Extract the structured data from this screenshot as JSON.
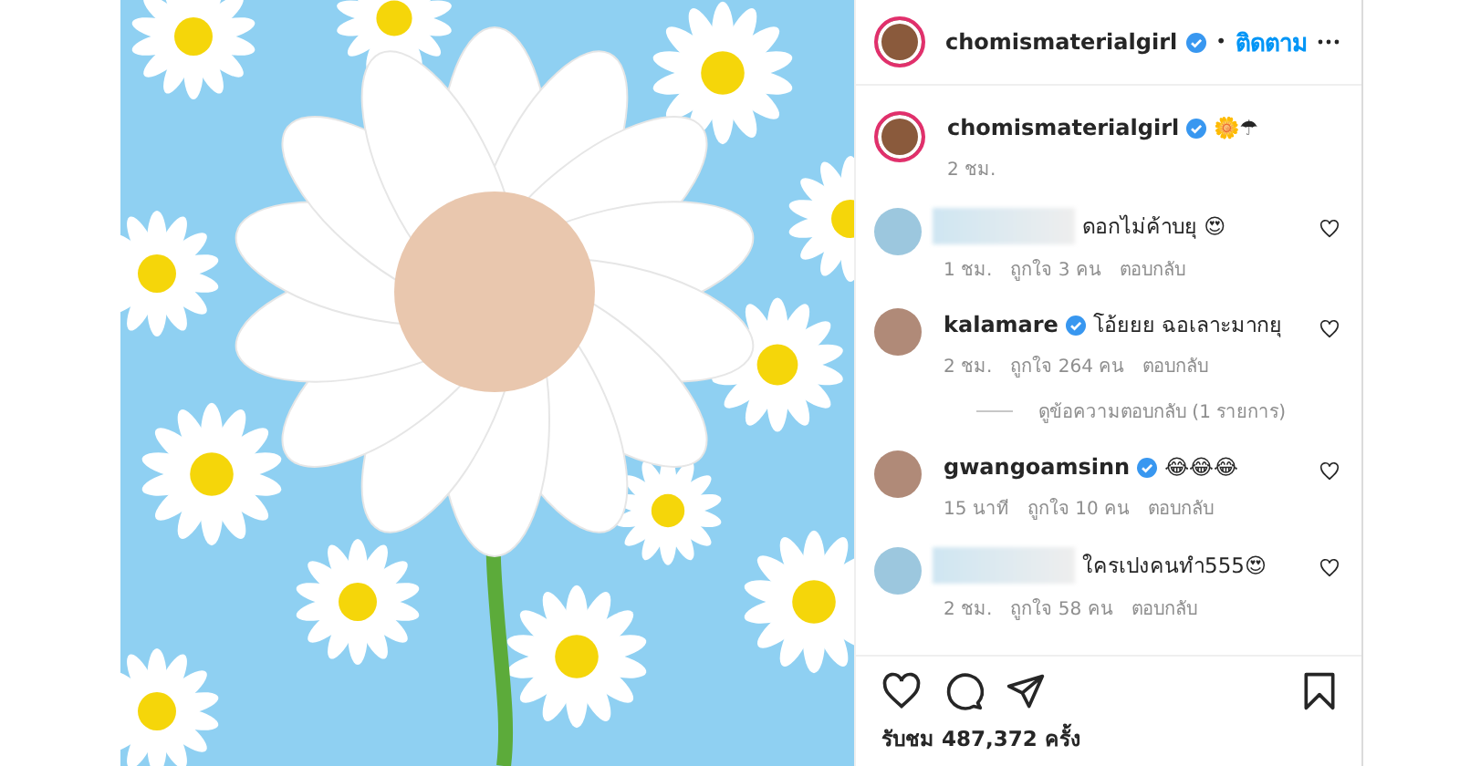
{
  "post": {
    "username": "chomismaterialgirl",
    "verified": true,
    "separator": "•",
    "follow": "ติดตาม"
  },
  "caption": {
    "username": "chomismaterialgirl",
    "verified": true,
    "text": "🌼☂",
    "time": "2 ชม."
  },
  "comments": [
    {
      "kind": "redacted",
      "text": "ดอกไม่ค้าบยุ 😍",
      "time": "1 ชม.",
      "likes": "ถูกใจ 3 คน",
      "reply": "ตอบกลับ",
      "liked": false
    },
    {
      "kind": "user",
      "username": "kalamare",
      "verified": true,
      "text": "โอ้ยยย ฉอเลาะมากยุ",
      "time": "2 ชม.",
      "likes": "ถูกใจ 264 คน",
      "reply": "ตอบกลับ",
      "liked": false,
      "replies_link": "ดูข้อความตอบกลับ (1 รายการ)"
    },
    {
      "kind": "user",
      "username": "gwangoamsinn",
      "verified": true,
      "text": "😂😂😂",
      "time": "15 นาที",
      "likes": "ถูกใจ 10 คน",
      "reply": "ตอบกลับ",
      "liked": false
    },
    {
      "kind": "redacted",
      "text": "ใครเปงคนทำ555😍",
      "time": "2 ชม.",
      "likes": "ถูกใจ 58 คน",
      "reply": "ตอบกลับ",
      "liked": false
    }
  ],
  "footer": {
    "views": "รับชม 487,372 ครั้ง"
  }
}
